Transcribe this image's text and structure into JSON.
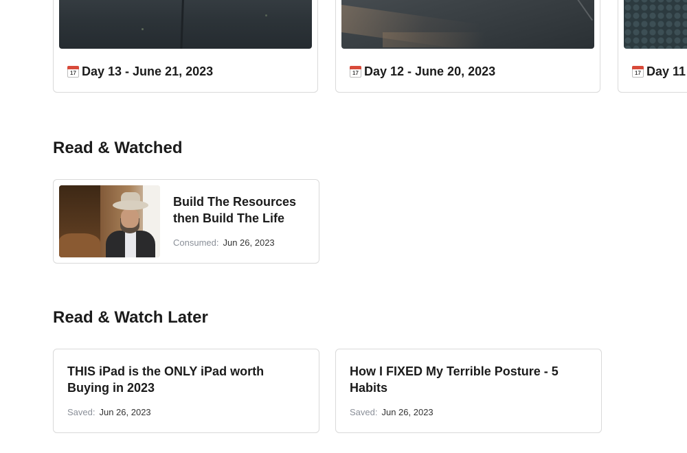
{
  "journal": {
    "cards": [
      {
        "title": "Day 13 - June 21, 2023",
        "icon": "calendar-icon",
        "calendar_day": "17"
      },
      {
        "title": "Day 12 - June 20, 2023",
        "icon": "calendar-icon",
        "calendar_day": "17"
      },
      {
        "title": "Day 11",
        "icon": "calendar-icon",
        "calendar_day": "17"
      }
    ]
  },
  "read_watched": {
    "heading": "Read & Watched",
    "items": [
      {
        "title": "Build The Resources then Build The Life",
        "meta_label": "Consumed:",
        "meta_value": "Jun 26, 2023"
      }
    ]
  },
  "read_watch_later": {
    "heading": "Read & Watch Later",
    "items": [
      {
        "title": "THIS iPad is the ONLY iPad worth Buying in 2023",
        "meta_label": "Saved:",
        "meta_value": "Jun 26, 2023"
      },
      {
        "title": "How I FIXED My Terrible Posture - 5 Habits",
        "meta_label": "Saved:",
        "meta_value": "Jun 26, 2023"
      }
    ]
  },
  "colors": {
    "border": "#d9d9d9",
    "text": "#1b1b1b",
    "muted": "#8a8f98",
    "calendar_red": "#d84a3a"
  }
}
